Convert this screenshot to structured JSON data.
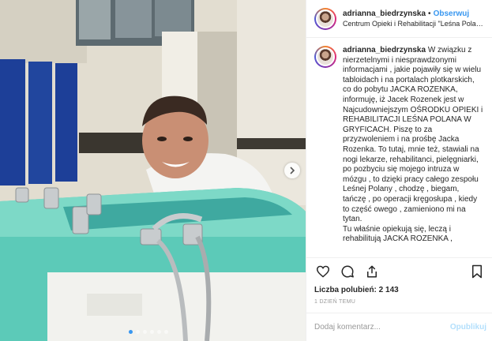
{
  "post": {
    "username": "adrianna_biedrzynska",
    "separator": "•",
    "follow_label": "Obserwuj",
    "location": "Centrum Opieki i Rehabilitacji \"Leśna Polan…",
    "caption_lines": [
      "W związku z",
      "nierzetelnymi i niesprawdzonymi",
      "informacjami , jakie pojawiły się w wielu",
      "tabloidach i na portalach plotkarskich,",
      "co do pobytu JACKA ROZENKA,",
      "informuję, iż Jacek Rozenek jest w",
      "Najcudowniejszym OŚRODKU OPIEKI i",
      "REHABILITACJI LEŚNA POLANA W",
      "GRYFICACH. Piszę to za",
      "przyzwoleniem i na prośbę Jacka",
      "Rozenka. To tutaj, mnie też, stawiali na",
      "nogi lekarze, rehabilitanci, pielęgniarki,",
      "po pozbyciu się mojego intruza w",
      "mózgu , to dzięki pracy całego zespołu",
      "Leśnej Polany , chodzę , biegam,",
      "tańczę , po operacji kręgosłupa , kiedy",
      "to część owego , zamieniono mi na",
      "tytan.",
      "Tu właśnie opiekują się, leczą i",
      "rehabilitują JACKA ROZENKA ,"
    ],
    "likes": "Liczba polubień: 2 143",
    "time_ago": "1 DZIEŃ TEMU",
    "comment_placeholder": "Dodaj komentarz...",
    "publish_label": "Opublikuj"
  },
  "carousel": {
    "dot_count": 6,
    "active_index": 0
  },
  "icons": {
    "like": "heart-icon",
    "comment": "comment-icon",
    "share": "share-icon",
    "save": "bookmark-icon",
    "next": "chevron-right-icon"
  },
  "colors": {
    "accent": "#3897f0",
    "publish_disabled": "#b2dffc",
    "tub": "#5ccab8"
  }
}
